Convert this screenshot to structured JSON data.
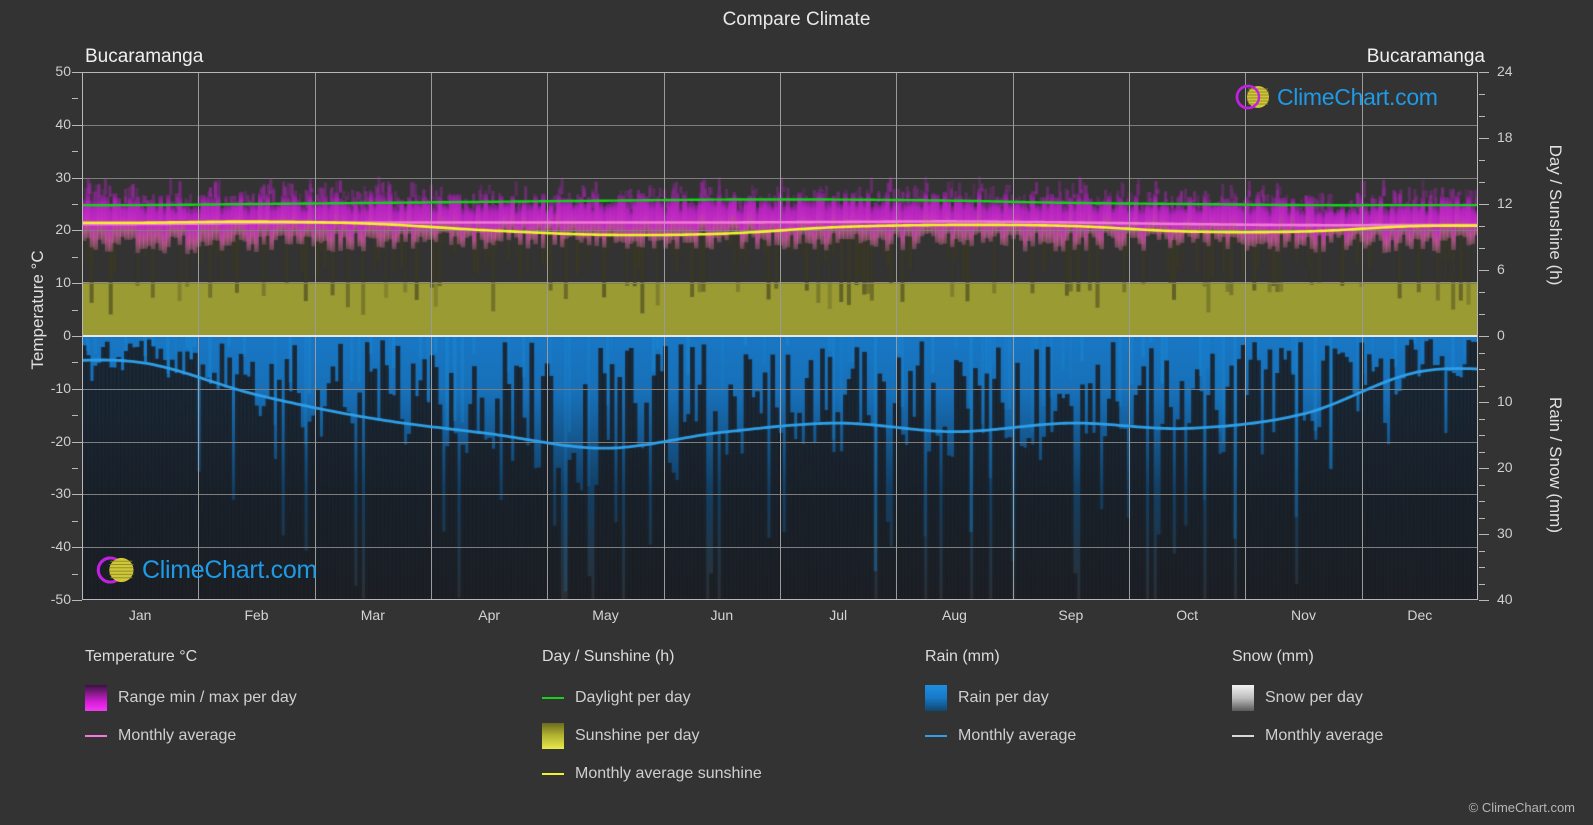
{
  "header": {
    "title": "Compare Climate",
    "location_left": "Bucaramanga",
    "location_right": "Bucaramanga"
  },
  "watermark": {
    "text": "ClimeChart.com",
    "logo_ring_color": "#c020e0",
    "logo_sphere_color": "#d8cf3a"
  },
  "copyright": "© ClimeChart.com",
  "axes": {
    "temperature": {
      "title": "Temperature °C",
      "ticks": [
        "50",
        "40",
        "30",
        "20",
        "10",
        "0",
        "-10",
        "-20",
        "-30",
        "-40",
        "-50"
      ],
      "min": -50,
      "max": 50
    },
    "day_sunshine": {
      "title": "Day / Sunshine (h)",
      "ticks": [
        "24",
        "18",
        "12",
        "6",
        "0"
      ],
      "min": 0,
      "max": 24
    },
    "rain_snow": {
      "title": "Rain / Snow (mm)",
      "ticks": [
        "0",
        "10",
        "20",
        "30",
        "40"
      ],
      "min": 0,
      "max": 40
    },
    "months": [
      "Jan",
      "Feb",
      "Mar",
      "Apr",
      "May",
      "Jun",
      "Jul",
      "Aug",
      "Sep",
      "Oct",
      "Nov",
      "Dec"
    ]
  },
  "legend": {
    "groups": [
      {
        "title": "Temperature °C",
        "items": [
          {
            "label": "Range min / max per day",
            "key": "swatch",
            "swatch_class": "sw-temp",
            "color": "#e01ee0"
          },
          {
            "label": "Monthly average",
            "key": "line",
            "color": "#f07ad8"
          }
        ]
      },
      {
        "title": "Day / Sunshine (h)",
        "items": [
          {
            "label": "Daylight per day",
            "key": "line",
            "color": "#16d21c"
          },
          {
            "label": "Sunshine per day",
            "key": "swatch",
            "swatch_class": "sw-sun",
            "color": "#e9e94a"
          },
          {
            "label": "Monthly average sunshine",
            "key": "line",
            "color": "#f2f22c"
          }
        ]
      },
      {
        "title": "Rain (mm)",
        "items": [
          {
            "label": "Rain per day",
            "key": "swatch",
            "swatch_class": "sw-rain",
            "color": "#1e8fe0"
          },
          {
            "label": "Monthly average",
            "key": "line",
            "color": "#2e9fe8"
          }
        ]
      },
      {
        "title": "Snow (mm)",
        "items": [
          {
            "label": "Snow per day",
            "key": "swatch",
            "swatch_class": "sw-snow",
            "color": "#e0e0e0"
          },
          {
            "label": "Monthly average",
            "key": "line",
            "color": "#d8d8d8"
          }
        ]
      }
    ]
  },
  "chart_data": {
    "type": "line",
    "title": "Compare Climate",
    "subtitle": "Bucaramanga",
    "xlabel": "",
    "ylabel": "Temperature °C",
    "categories": [
      "Jan",
      "Feb",
      "Mar",
      "Apr",
      "May",
      "Jun",
      "Jul",
      "Aug",
      "Sep",
      "Oct",
      "Nov",
      "Dec"
    ],
    "grid": true,
    "legend_position": "bottom",
    "axes": {
      "temperature_c": {
        "min": -50,
        "max": 50,
        "ticks": [
          50,
          40,
          30,
          20,
          10,
          0,
          -10,
          -20,
          -30,
          -40,
          -50
        ]
      },
      "day_sunshine_h": {
        "min": 0,
        "max": 24,
        "ticks": [
          24,
          18,
          12,
          6,
          0
        ]
      },
      "rain_snow_mm": {
        "min": 0,
        "max": 40,
        "ticks": [
          0,
          10,
          20,
          30,
          40
        ]
      }
    },
    "series": [
      {
        "name": "Monthly average temperature",
        "axis": "temperature_c",
        "unit": "°C",
        "color": "#f07ad8",
        "values": [
          21.2,
          21.4,
          21.5,
          21.5,
          21.5,
          21.5,
          21.6,
          21.7,
          21.5,
          21.2,
          21.0,
          21.0
        ]
      },
      {
        "name": "Range max per day (temperature)",
        "axis": "temperature_c",
        "unit": "°C",
        "color": "#c41ec4",
        "values": [
          25.0,
          25.3,
          25.3,
          25.0,
          25.0,
          25.2,
          25.5,
          25.6,
          25.3,
          24.8,
          24.5,
          24.6
        ]
      },
      {
        "name": "Range min per day (temperature)",
        "axis": "temperature_c",
        "unit": "°C",
        "color": "#c41ec4",
        "values": [
          17.2,
          17.5,
          17.8,
          18.2,
          18.2,
          18.0,
          17.8,
          17.8,
          17.8,
          17.8,
          17.6,
          17.4
        ]
      },
      {
        "name": "Daylight per day",
        "axis": "day_sunshine_h",
        "unit": "h",
        "color": "#16d21c",
        "values": [
          11.9,
          12.0,
          12.1,
          12.2,
          12.3,
          12.4,
          12.4,
          12.3,
          12.1,
          12.0,
          11.9,
          11.9
        ]
      },
      {
        "name": "Monthly average sunshine",
        "axis": "day_sunshine_h",
        "unit": "h",
        "color": "#f2f22c",
        "values": [
          10.3,
          10.4,
          10.2,
          9.6,
          9.2,
          9.3,
          9.9,
          10.1,
          10.0,
          9.5,
          9.5,
          10.0
        ]
      },
      {
        "name": "Monthly average rain",
        "axis": "rain_snow_mm",
        "unit": "mm",
        "color": "#2e9fe8",
        "values": [
          4.0,
          8.9,
          12.5,
          14.8,
          17.0,
          14.6,
          13.2,
          14.5,
          13.2,
          14.0,
          11.8,
          5.4
        ]
      },
      {
        "name": "Monthly average snow",
        "axis": "rain_snow_mm",
        "unit": "mm",
        "color": "#d8d8d8",
        "values": [
          0,
          0,
          0,
          0,
          0,
          0,
          0,
          0,
          0,
          0,
          0,
          0
        ]
      }
    ]
  }
}
